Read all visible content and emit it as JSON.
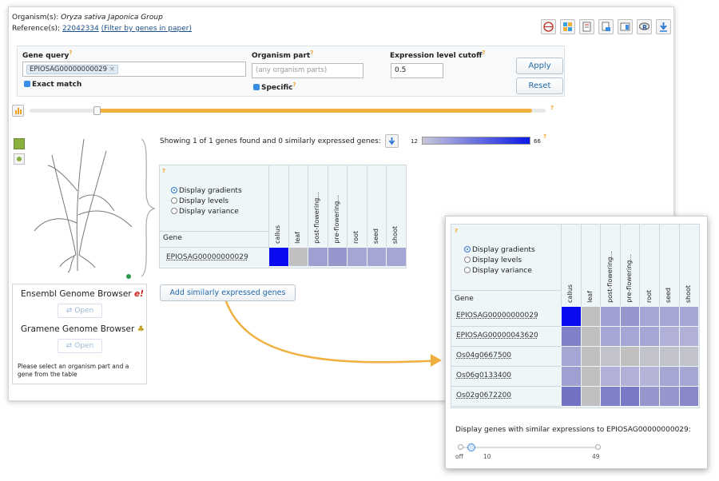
{
  "header": {
    "organism_label": "Organism(s):",
    "organism_value": "Oryza sativa Japonica Group",
    "reference_label": "Reference(s):",
    "reference_id": "22042334",
    "reference_filter": "(Filter by genes in paper)"
  },
  "toolbar_icons": [
    "globe-icon",
    "heatmap-icon",
    "experiment-design-icon",
    "download-icon",
    "layout-icon",
    "r-icon",
    "download-arrow-icon"
  ],
  "query": {
    "gene_label": "Gene query",
    "gene_tag": "EPIOSAG00000000029",
    "exact_match": "Exact match",
    "organism_part_label": "Organism part",
    "organism_part_placeholder": "(any organism parts)",
    "specific": "Specific",
    "cutoff_label": "Expression level cutoff",
    "cutoff_value": "0.5",
    "apply": "Apply",
    "reset": "Reset"
  },
  "slider_progress": 0.97,
  "showing_text": "Showing 1 of 1 genes found and 0 similarly expressed genes:",
  "gradient": {
    "min": "12",
    "max": "66",
    "low_color": "#c8c8d8",
    "high_color": "#0a18e6"
  },
  "display_options": [
    "Display gradients",
    "Display levels",
    "Display variance"
  ],
  "gene_col_label": "Gene",
  "columns": [
    "callus",
    "leaf",
    "post-flowering...",
    "pre-flowering...",
    "root",
    "seed",
    "shoot"
  ],
  "main_row": {
    "gene": "EPIOSAG00000000029",
    "colors": [
      "#0b0bef",
      "#c0c0c0",
      "#9f9fd2",
      "#9696cc",
      "#a6a6d4",
      "#a6a6d4",
      "#a6a6d4"
    ]
  },
  "add_genes_button": "Add similarly expressed genes",
  "browsers": {
    "ensembl": "Ensembl Genome Browser",
    "gramene": "Gramene Genome Browser",
    "open": "Open",
    "help": "Please select an organism part and a gene from the table"
  },
  "zoom": {
    "rows": [
      {
        "gene": "EPIOSAG00000000029",
        "colors": [
          "#0b0bef",
          "#c0c0c0",
          "#9f9fd2",
          "#9696cc",
          "#a6a6d4",
          "#a6a6d4",
          "#a6a6d4"
        ]
      },
      {
        "gene": "EPIOSAG00000043620",
        "colors": [
          "#8080c8",
          "#c0c0c0",
          "#a6a6d4",
          "#a6a6d4",
          "#a6a6d4",
          "#b0b0d8",
          "#b0b0d8"
        ]
      },
      {
        "gene": "Os04g0667500",
        "colors": [
          "#a6a6d4",
          "#c0c0c0",
          "#c2c2cc",
          "#c0c0c0",
          "#c2c2cc",
          "#c2c2cc",
          "#c2c2cc"
        ]
      },
      {
        "gene": "Os06g0133400",
        "colors": [
          "#9f9fd2",
          "#c0c0c0",
          "#b0b0d8",
          "#b0b0d8",
          "#b4b4d8",
          "#a6a6d4",
          "#a6a6d4"
        ]
      },
      {
        "gene": "Os02g0672200",
        "colors": [
          "#7272c4",
          "#c0c0c0",
          "#8080c8",
          "#7878c6",
          "#9696cc",
          "#9696cc",
          "#8888c8"
        ]
      }
    ],
    "similar_text": "Display genes with similar expressions to EPIOSAG00000000029:",
    "slider_labels": [
      "off",
      "10",
      "49"
    ]
  }
}
